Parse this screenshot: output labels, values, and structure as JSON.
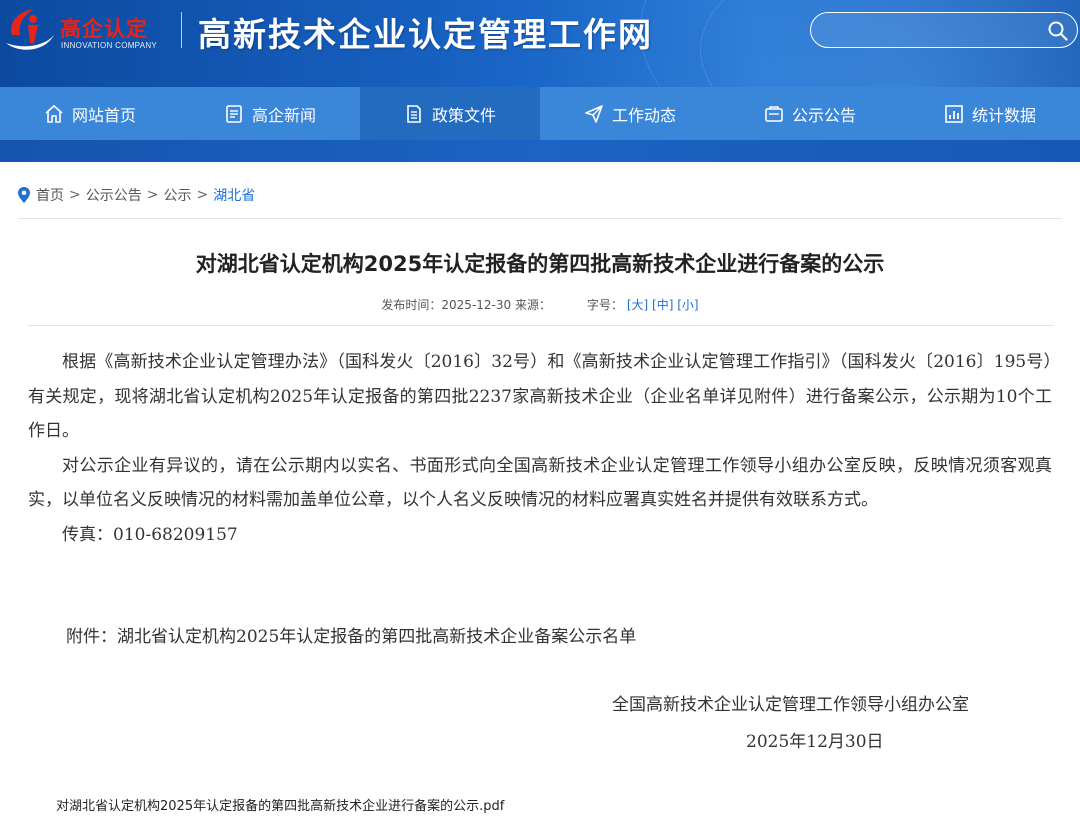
{
  "header": {
    "logo_text": "高企认定",
    "logo_sub": "INNOVATION COMPANY",
    "site_title": "高新技术企业认定管理工作网",
    "search_placeholder": ""
  },
  "nav": {
    "items": [
      {
        "label": "网站首页",
        "icon": "home-icon"
      },
      {
        "label": "高企新闻",
        "icon": "news-icon"
      },
      {
        "label": "政策文件",
        "icon": "document-icon"
      },
      {
        "label": "工作动态",
        "icon": "send-icon"
      },
      {
        "label": "公示公告",
        "icon": "notice-icon"
      },
      {
        "label": "统计数据",
        "icon": "chart-icon"
      }
    ],
    "active_index": 2
  },
  "breadcrumb": {
    "items": [
      "首页",
      "公示公告",
      "公示"
    ],
    "current": "湖北省",
    "separator": ">"
  },
  "article": {
    "title": "对湖北省认定机构2025年认定报备的第四批高新技术企业进行备案的公示",
    "meta_time_label": "发布时间：2025-12-30 来源：",
    "meta_fontsize_label": "字号：",
    "font_large": "[大]",
    "font_medium": "[中]",
    "font_small": "[小]",
    "paragraphs": [
      "根据《高新技术企业认定管理办法》（国科发火〔2016〕32号）和《高新技术企业认定管理工作指引》（国科发火〔2016〕195号）有关规定，现将湖北省认定机构2025年认定报备的第四批2237家高新技术企业（企业名单详见附件）进行备案公示，公示期为10个工作日。",
      "对公示企业有异议的，请在公示期内以实名、书面形式向全国高新技术企业认定管理工作领导小组办公室反映，反映情况须客观真实，以单位名义反映情况的材料需加盖单位公章，以个人名义反映情况的材料应署真实姓名并提供有效联系方式。",
      "传真：010-68209157"
    ],
    "attachment_line": "附件：湖北省认定机构2025年认定报备的第四批高新技术企业备案公示名单",
    "sign_org": "全国高新技术企业认定管理工作领导小组办公室",
    "sign_date": "2025年12月30日",
    "pdf_link": "对湖北省认定机构2025年认定报备的第四批高新技术企业进行备案的公示.pdf"
  },
  "colors": {
    "header_blue": "#1863c4",
    "nav_blue": "#3a86d8",
    "nav_active": "#236bbf",
    "link_blue": "#1f6fd0",
    "logo_red": "#e8231a"
  }
}
